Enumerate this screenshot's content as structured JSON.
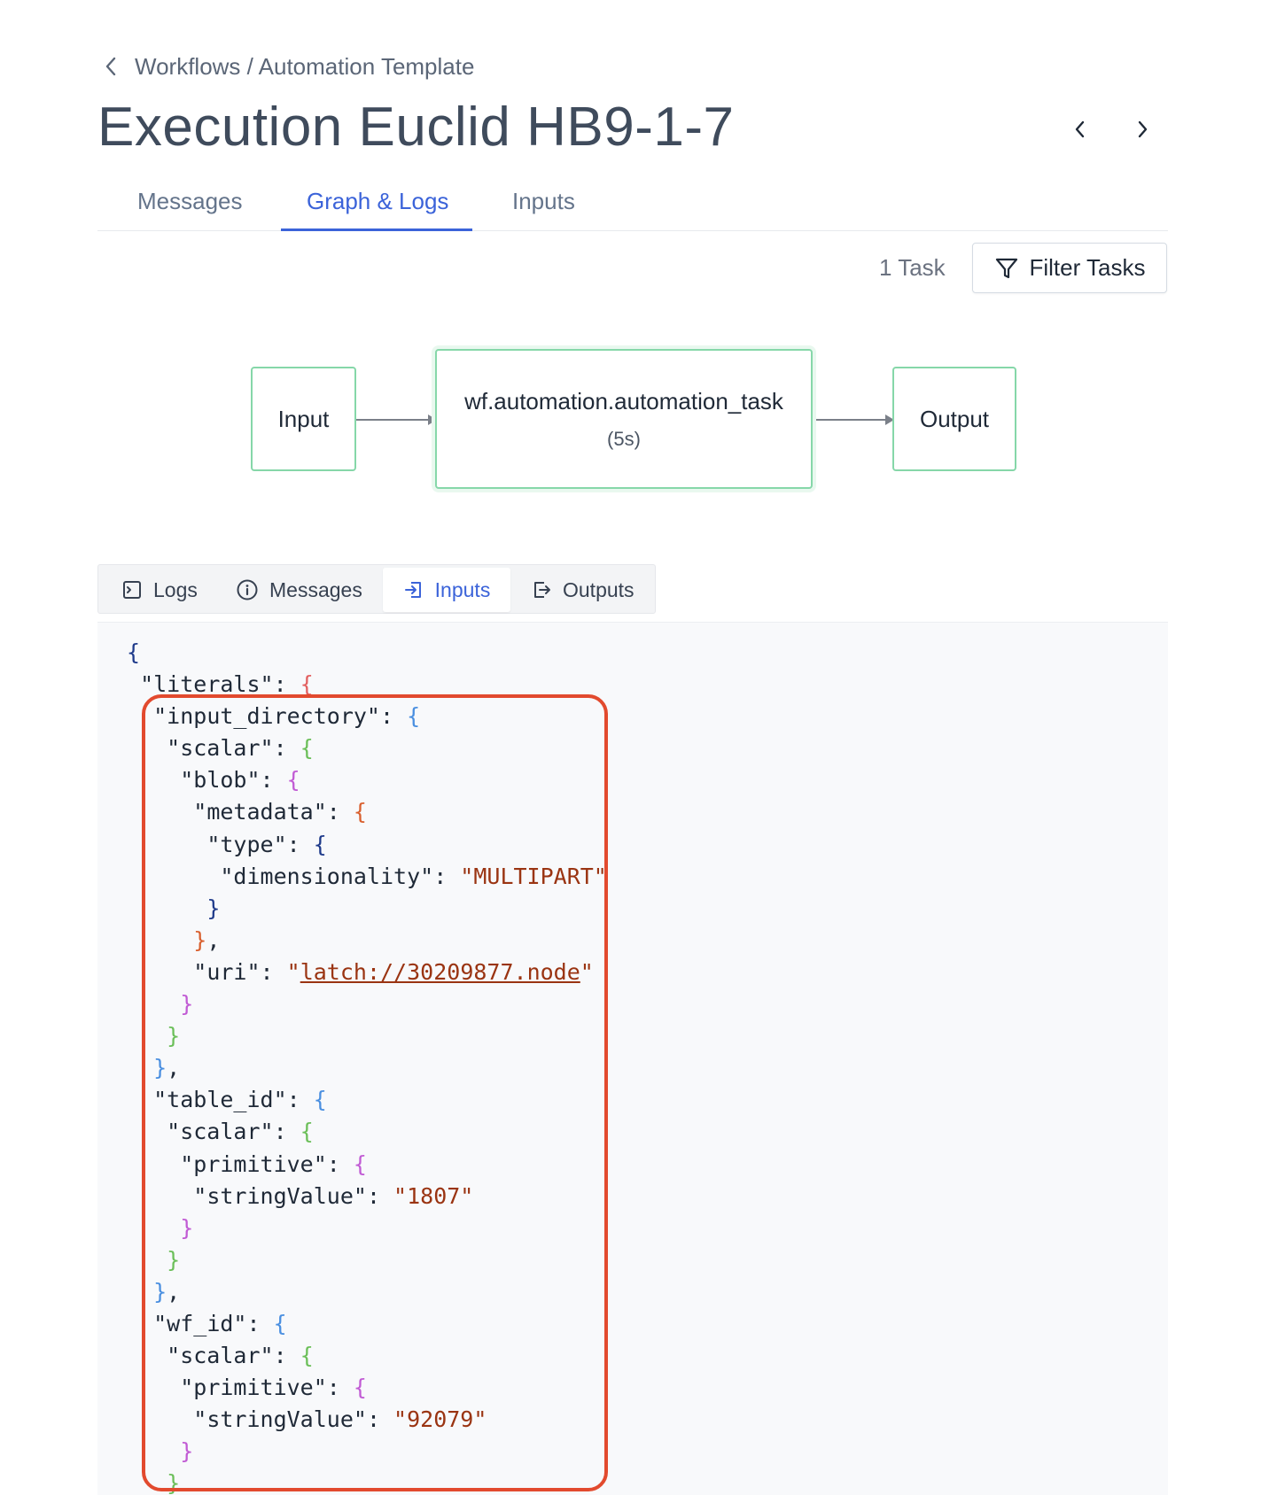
{
  "breadcrumb": {
    "text": "Workflows / Automation Template"
  },
  "page": {
    "title": "Execution Euclid HB9-1-7"
  },
  "tabs": [
    {
      "label": "Messages"
    },
    {
      "label": "Graph & Logs",
      "active": true
    },
    {
      "label": "Inputs"
    }
  ],
  "toolbar": {
    "task_count": "1 Task",
    "filter_label": "Filter Tasks"
  },
  "graph": {
    "input_label": "Input",
    "task_label": "wf.automation.automation_task",
    "task_duration": "(5s)",
    "output_label": "Output"
  },
  "sub_tabs": [
    {
      "label": "Logs",
      "icon": "terminal-icon"
    },
    {
      "label": "Messages",
      "icon": "info-icon"
    },
    {
      "label": "Inputs",
      "icon": "sign-in-icon",
      "active": true
    },
    {
      "label": "Outputs",
      "icon": "sign-out-icon"
    }
  ],
  "json_view": {
    "key_literals": "\"literals\"",
    "key_input_directory": "\"input_directory\"",
    "key_scalar": "\"scalar\"",
    "key_blob": "\"blob\"",
    "key_metadata": "\"metadata\"",
    "key_type": "\"type\"",
    "key_dimensionality": "\"dimensionality\"",
    "val_dimensionality": "\"MULTIPART\"",
    "key_uri": "\"uri\"",
    "val_uri": "latch://30209877.node",
    "key_table_id": "\"table_id\"",
    "key_primitive": "\"primitive\"",
    "key_stringValue": "\"stringValue\"",
    "val_table_id": "\"1807\"",
    "key_wf_id": "\"wf_id\"",
    "val_wf_id": "\"92079\""
  },
  "colors": {
    "accent": "#3b63d9",
    "node_border": "#86d7a9",
    "highlight": "#e24a2e",
    "string": "#9a3412"
  }
}
